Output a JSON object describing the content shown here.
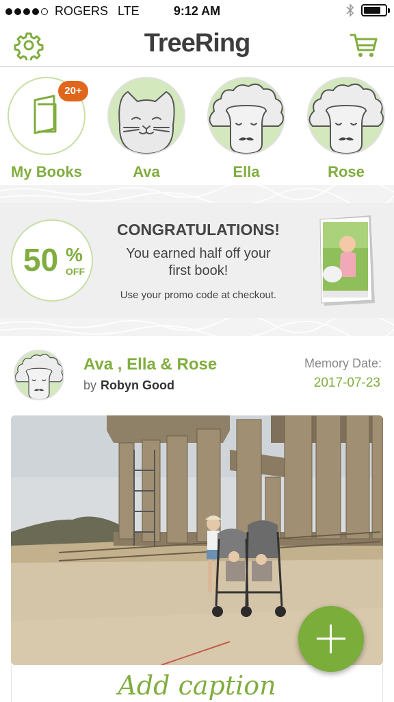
{
  "status_bar": {
    "carrier": "ROGERS",
    "network": "LTE",
    "time": "9:12 AM",
    "battery_level": 0.8
  },
  "nav": {
    "logo": "TreeRing",
    "settings_icon": "gear-icon",
    "cart_icon": "cart-icon"
  },
  "kids": [
    {
      "label": "My Books",
      "badge": "20+",
      "icon": "book-icon"
    },
    {
      "label": "Ava",
      "icon": "cat-avatar-icon"
    },
    {
      "label": "Ella",
      "icon": "sheep-avatar-icon"
    },
    {
      "label": "Rose",
      "icon": "sheep-avatar-icon"
    }
  ],
  "promo": {
    "percent": "50",
    "percent_sign": "%",
    "off_word": "OFF",
    "title": "CONGRATULATIONS!",
    "subtitle_line1": "You earned half off your",
    "subtitle_line2": "first book!",
    "note": "Use your promo code at checkout.",
    "book_image": "yearbook-cover-image"
  },
  "post": {
    "title": "Ava , Ella & Rose",
    "by_prefix": "by",
    "author": "Robyn Good",
    "memory_label": "Memory Date:",
    "memory_date": "2017-07-23",
    "photo": "temple-ruins-photo",
    "caption_placeholder": "Add caption"
  },
  "fab": {
    "icon": "plus-icon"
  },
  "colors": {
    "brand_green": "#80ad3f",
    "badge_orange": "#e0661c",
    "fab_green": "#7aad3a"
  }
}
